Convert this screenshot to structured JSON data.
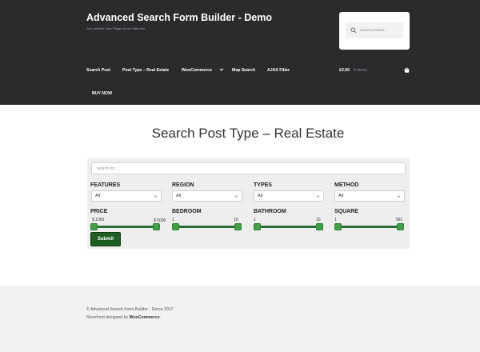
{
  "header": {
    "site_title": "Advanced Search Form Builder - Demo",
    "tagline": "Just another Cat's Plugin Demo Sites site",
    "search_placeholder": "Search products…",
    "nav": [
      {
        "label": "Search Post"
      },
      {
        "label": "Post Type – Real Estate"
      },
      {
        "label": "WooCommerce"
      },
      {
        "label": "Map Search"
      },
      {
        "label": "AJAX Filter"
      },
      {
        "label": "BUY NOW"
      }
    ],
    "cart_amount": "£0.00",
    "cart_items": "0 items"
  },
  "main": {
    "title": "Search Post Type – Real Estate",
    "form": {
      "search_placeholder": "search for ...",
      "selects": [
        {
          "label": "FEATURES",
          "value": "All"
        },
        {
          "label": "REGION",
          "value": "All"
        },
        {
          "label": "TYPES",
          "value": "All"
        },
        {
          "label": "METHOD",
          "value": "All"
        }
      ],
      "ranges": [
        {
          "label": "PRICE",
          "min_label": "$ 1000",
          "max_label": "$ 5000",
          "min": 1000,
          "max": 5000
        },
        {
          "label": "BEDROOM",
          "min_label": "1",
          "max_label": "10",
          "min": 1,
          "max": 10
        },
        {
          "label": "BATHROOM",
          "min_label": "1",
          "max_label": "10",
          "min": 1,
          "max": 10
        },
        {
          "label": "SQUARE",
          "min_label": "1",
          "max_label": "991",
          "min": 1,
          "max": 991
        }
      ],
      "submit_label": "Submit"
    }
  },
  "footer": {
    "copyright": "© Advanced Search Form Builder - Demo 2017",
    "designed_prefix": "Storefront designed by ",
    "designed_by": "WooCommerce",
    "designed_suffix": "."
  },
  "colors": {
    "header_bg": "#2b2b2e",
    "slider_green": "#43a047",
    "submit_green": "#1e5e22"
  }
}
